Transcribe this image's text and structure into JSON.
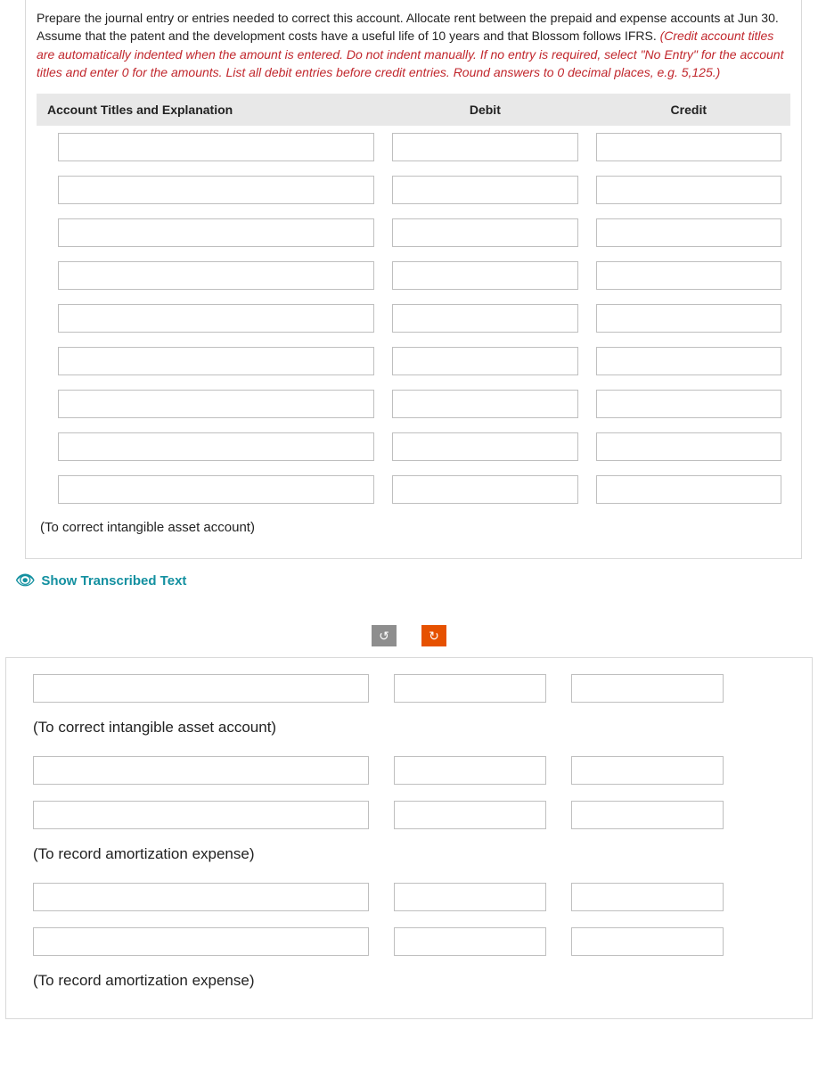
{
  "question": {
    "instruction_plain": "Prepare the journal entry or entries needed to correct this account. Allocate rent between the prepaid and expense accounts at Jun 30. Assume that the patent and the development costs have a useful life of 10 years and that Blossom follows IFRS. ",
    "instruction_red": "(Credit account titles are automatically indented when the amount is entered. Do not indent manually. If no entry is required, select \"No Entry\" for the account titles and enter 0 for the amounts. List all debit entries before credit entries. Round answers to 0 decimal places, e.g. 5,125.)",
    "headers": {
      "account": "Account Titles and Explanation",
      "debit": "Debit",
      "credit": "Credit"
    },
    "rows": [
      {
        "acct": "",
        "debit": "",
        "credit": ""
      },
      {
        "acct": "",
        "debit": "",
        "credit": ""
      },
      {
        "acct": "",
        "debit": "",
        "credit": ""
      },
      {
        "acct": "",
        "debit": "",
        "credit": ""
      },
      {
        "acct": "",
        "debit": "",
        "credit": ""
      },
      {
        "acct": "",
        "debit": "",
        "credit": ""
      },
      {
        "acct": "",
        "debit": "",
        "credit": ""
      },
      {
        "acct": "",
        "debit": "",
        "credit": ""
      },
      {
        "acct": "",
        "debit": "",
        "credit": ""
      }
    ],
    "footnote": "(To correct intangible asset account)"
  },
  "show_transcribed_label": "Show Transcribed Text",
  "nav": {
    "prev": "↺",
    "next": "↻"
  },
  "answer": {
    "groups": [
      {
        "rows": [
          {
            "acct": "",
            "debit": "",
            "credit": ""
          }
        ],
        "label": "(To correct intangible asset account)"
      },
      {
        "rows": [
          {
            "acct": "",
            "debit": "",
            "credit": ""
          },
          {
            "acct": "",
            "debit": "",
            "credit": ""
          }
        ],
        "label": "(To record amortization expense)"
      },
      {
        "rows": [
          {
            "acct": "",
            "debit": "",
            "credit": ""
          },
          {
            "acct": "",
            "debit": "",
            "credit": ""
          }
        ],
        "label": "(To record amortization expense)"
      }
    ]
  }
}
